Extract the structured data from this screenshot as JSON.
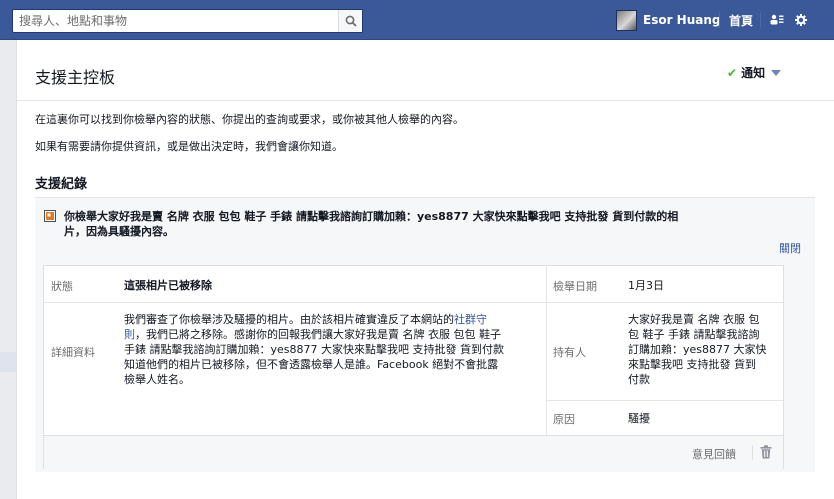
{
  "header": {
    "search_placeholder": "搜尋人、地點和事物",
    "user_name": "Esor Huang",
    "home_label": "首頁"
  },
  "page": {
    "title": "支援主控板",
    "notify_label": "通知",
    "intro_line1": "在這裏你可以找到你檢舉內容的狀態、你提出的查詢或要求，或你被其他人檢舉的內容。",
    "intro_line2": "如果有需要請你提供資訊，或是做出決定時，我們會讓你知道。",
    "section_title": "支援紀錄"
  },
  "report": {
    "summary_line1": "你檢舉大家好我是賣 名牌 衣服 包包 鞋子 手錶 請點擊我諮詢訂購加賴：yes8877 大家快來點擊我吧 支持批發 貨到付款的相",
    "summary_line2": "片，因為具騷擾內容。",
    "unfollow_label": "關閉",
    "status_label": "狀態",
    "status_value": "這張相片已被移除",
    "details_label": "詳細資料",
    "details_line1": "我們審查了你檢舉涉及騷擾的相片。由於該相片確實違反了本網站的",
    "details_link_a": "社群守",
    "details_link_b": "則",
    "details_line2": "，我們已將之移除。感謝你的回報我們讓大家好我是賣 名牌 衣服 包包 鞋子",
    "details_line3": "手錶 請點擊我諮詢訂購加賴：yes8877 大家快來點擊我吧 支持批發 貨到付款",
    "details_line4": "知道他們的相片已被移除，但不會透露檢舉人是誰。Facebook 絕對不會批露",
    "details_line5": "檢舉人姓名。",
    "date_label": "檢舉日期",
    "date_value": "1月3日",
    "owner_label": "持有人",
    "owner_line1": "大家好我是賣 名牌 衣服 包",
    "owner_line2": "包 鞋子 手錶 請點擊我諮詢",
    "owner_line3": "訂購加賴：yes8877 大家快",
    "owner_line4": "來點擊我吧 支持批發 貨到",
    "owner_line5": "付款",
    "reason_label": "原因",
    "reason_value": "騷擾",
    "feedback_label": "意見回饋"
  },
  "icons": {
    "search": "search-icon",
    "friends": "friend-requests-icon",
    "settings": "gear-icon",
    "trash": "trash-icon",
    "report": "photo-report-icon"
  },
  "colors": {
    "brand_blue": "#3b5998",
    "link": "#365899",
    "check_green": "#42b72a"
  }
}
